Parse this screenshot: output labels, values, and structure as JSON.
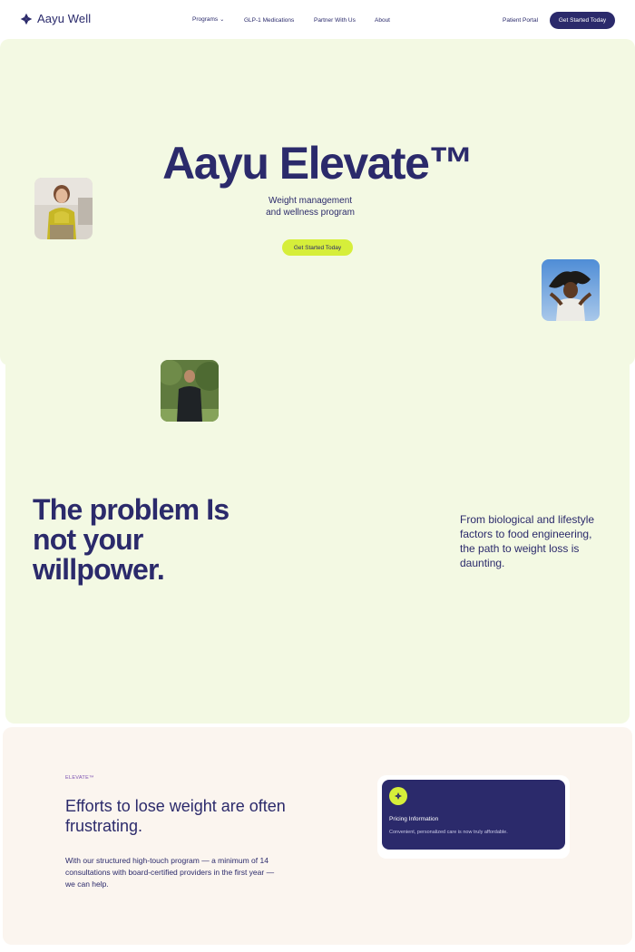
{
  "nav": {
    "logo_text": "Aayu Well",
    "links": [
      {
        "label": "Programs",
        "chevron": "⌄"
      },
      {
        "label": "GLP-1 Medications"
      },
      {
        "label": "Partner With Us"
      },
      {
        "label": "About"
      }
    ],
    "patient_portal": "Patient Portal",
    "cta": "Get Started Today"
  },
  "hero": {
    "title": "Aayu Elevate™",
    "subtitle": "Weight management and wellness program",
    "cta": "Get Started Today"
  },
  "problem": {
    "title": "The problem Is not your willpower.",
    "text": "From biological and lifestyle factors to food engineering, the path to weight loss is daunting."
  },
  "elevate": {
    "eyebrow": "ELEVATE™",
    "title": "Efforts to lose weight are often frustrating.",
    "text": "With our structured high-touch program — a minimum of 14 consultations with board-certified providers in the first year — we can help."
  },
  "pricing": {
    "title": "Pricing Information",
    "subtitle": "Convenient, personalized care is now truly affordable.",
    "icon": "flower-icon"
  },
  "colors": {
    "brand_navy": "#2b2a6b",
    "accent_lime": "#d6ee3a",
    "hero_bg": "#f3f9e3",
    "section_bg": "#fbf5ef"
  }
}
